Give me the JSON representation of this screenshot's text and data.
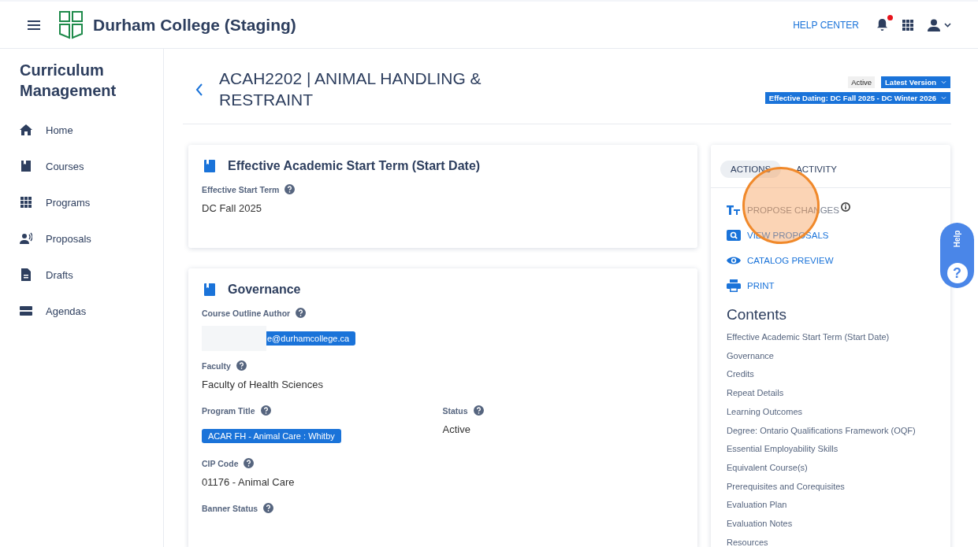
{
  "top_bar": {
    "brand": "Durham College (Staging)",
    "help_center": "HELP CENTER",
    "notification_dot": true
  },
  "sidebar": {
    "title": "Curriculum Management",
    "items": [
      {
        "label": "Home",
        "selected": false
      },
      {
        "label": "Courses",
        "selected": false
      },
      {
        "label": "Programs",
        "selected": false
      },
      {
        "label": "Proposals",
        "selected": false
      },
      {
        "label": "Drafts",
        "selected": false
      },
      {
        "label": "Agendas",
        "selected": false
      }
    ]
  },
  "page": {
    "title": "ACAH2202 | ANIMAL HANDLING & RESTRAINT",
    "status": "Active",
    "version": "Latest Version",
    "effective_dating": "Effective Dating: DC Fall 2025 - DC Winter 2026"
  },
  "sections": [
    {
      "title": "Effective Academic Start Term (Start Date)",
      "rows": [
        [
          {
            "label": "Effective Start Term",
            "kind": "text",
            "value": "DC Fall 2025"
          }
        ]
      ]
    },
    {
      "title": "Governance",
      "rows": [
        [
          {
            "label": "Course Outline Author",
            "kind": "redacted-tag",
            "value": "e@durhamcollege.ca"
          }
        ],
        [
          {
            "label": "Faculty",
            "kind": "text",
            "value": "Faculty of Health Sciences"
          }
        ],
        [
          {
            "label": "Program Title",
            "kind": "tag",
            "value": "ACAR FH - Animal Care : Whitby"
          },
          {
            "label": "Status",
            "kind": "text",
            "value": "Active"
          }
        ],
        [
          {
            "label": "CIP Code",
            "kind": "text",
            "value": "01176 - Animal Care"
          }
        ],
        [
          {
            "label": "Banner Status",
            "kind": "label-only"
          }
        ]
      ]
    }
  ],
  "side_panel": {
    "tabs": [
      {
        "label": "ACTIONS",
        "selected": true
      },
      {
        "label": "ACTIVITY",
        "selected": false
      }
    ],
    "actions": [
      {
        "label": "PROPOSE CHANGES",
        "disabled": true,
        "info": true
      },
      {
        "label": "VIEW PROPOSALS",
        "disabled": false,
        "info": false
      },
      {
        "label": "CATALOG PREVIEW",
        "disabled": false,
        "info": false
      },
      {
        "label": "PRINT",
        "disabled": false,
        "info": false
      }
    ],
    "contents_title": "Contents",
    "contents": [
      "Effective Academic Start Term (Start Date)",
      "Governance",
      "Credits",
      "Repeat Details",
      "Learning Outcomes",
      "Degree: Ontario Qualifications Framework (OQF)",
      "Essential Employability Skills",
      "Equivalent Course(s)",
      "Prerequisites and Corequisites",
      "Evaluation Plan",
      "Evaluation Notes",
      "Resources"
    ]
  },
  "help_tab": {
    "label": "Help",
    "icon_text": "?"
  }
}
